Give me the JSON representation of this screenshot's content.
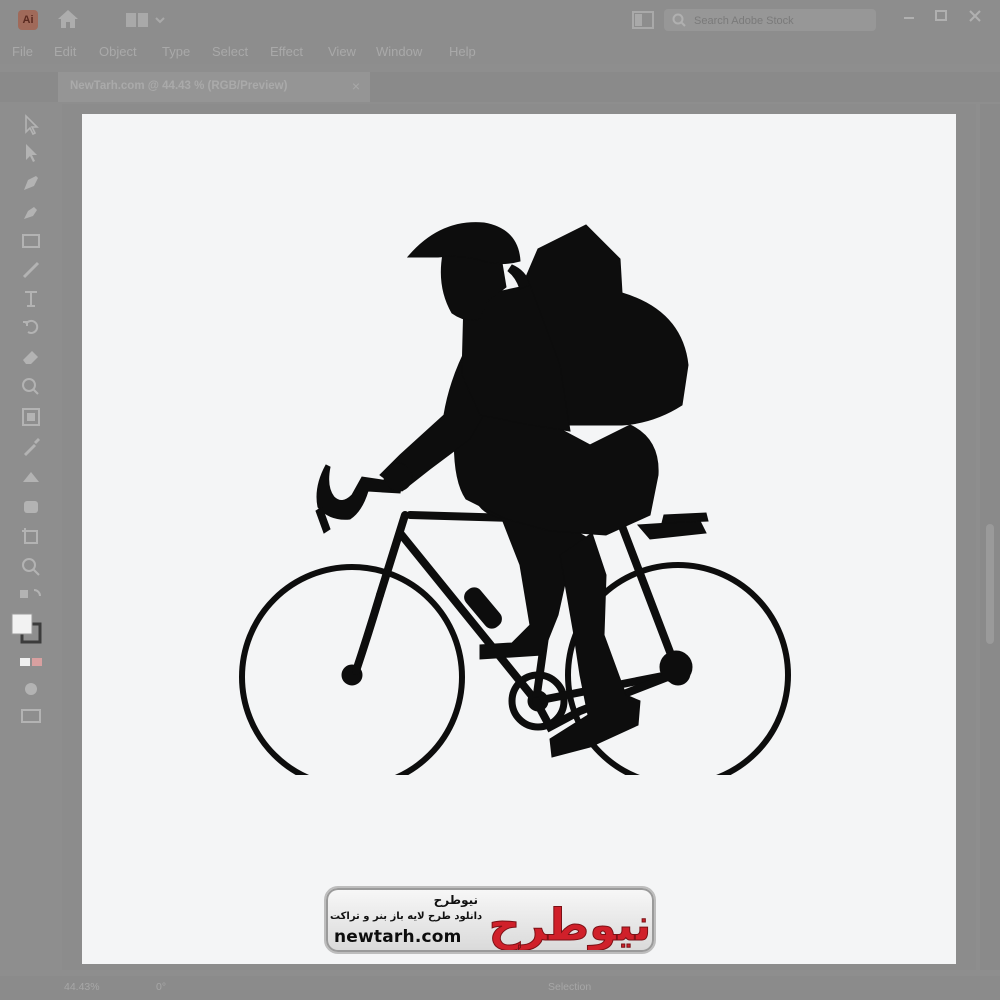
{
  "app": {
    "logo_text": "Ai",
    "search_placeholder": "Search Adobe Stock"
  },
  "menu": {
    "items": [
      "File",
      "Edit",
      "Object",
      "Type",
      "Select",
      "Effect",
      "View",
      "Window",
      "Help"
    ]
  },
  "document_tab": {
    "title": "NewTarh.com @ 44.43 % (RGB/Preview)",
    "close": "×"
  },
  "toolbar": {
    "tools": [
      "selection-tool",
      "direct-selection-tool",
      "pen-tool",
      "curvature-tool",
      "rectangle-tool",
      "pencil-tool",
      "type-tool",
      "rotate-tool",
      "eraser-tool",
      "shape-builder-tool",
      "free-transform-tool",
      "eyedropper-tool",
      "blend-tool",
      "symbol-sprayer-tool",
      "artboard-tool",
      "zoom-tool"
    ]
  },
  "artwork": {
    "subject": "cyclist-silhouette-with-backpack"
  },
  "watermark": {
    "brand_fa": "نیوطرح",
    "tagline_fa": "دانلود طرح لایه باز بنر و تراکت",
    "url": "newtarh.com",
    "logo_fa": "نیوطرح",
    "colors": {
      "primary": "#d0202a",
      "text": "#111111"
    }
  },
  "status_bar": {
    "zoom": "44.43%",
    "rotation": "0°",
    "tool": "Selection"
  },
  "colors": {
    "chrome": "#8d8d8d",
    "artboard": "#f4f5f6",
    "silhouette": "#0d0d0d"
  }
}
